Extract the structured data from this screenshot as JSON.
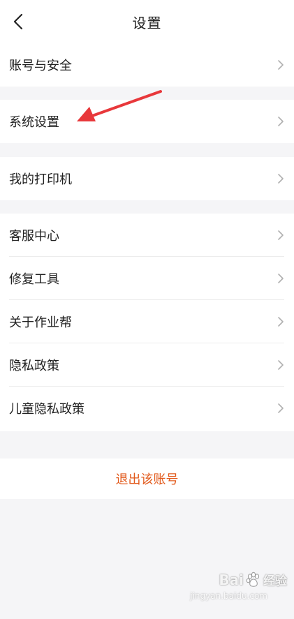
{
  "header": {
    "title": "设置"
  },
  "groups": [
    {
      "items": [
        {
          "label": "账号与安全"
        }
      ]
    },
    {
      "items": [
        {
          "label": "系统设置"
        }
      ]
    },
    {
      "items": [
        {
          "label": "我的打印机"
        }
      ]
    },
    {
      "items": [
        {
          "label": "客服中心"
        },
        {
          "label": "修复工具"
        },
        {
          "label": "关于作业帮"
        },
        {
          "label": "隐私政策"
        },
        {
          "label": "儿童隐私政策"
        }
      ]
    }
  ],
  "logout": {
    "label": "退出该账号"
  },
  "annotation": {
    "arrow_color": "#e8383b"
  },
  "watermark": {
    "brand_left": "Bai",
    "brand_right": "经验",
    "sub": "jingyan.baidu.com"
  },
  "colors": {
    "accent": "#e25a1c",
    "background": "#f5f5f7",
    "chevron": "#b0b0b0"
  }
}
